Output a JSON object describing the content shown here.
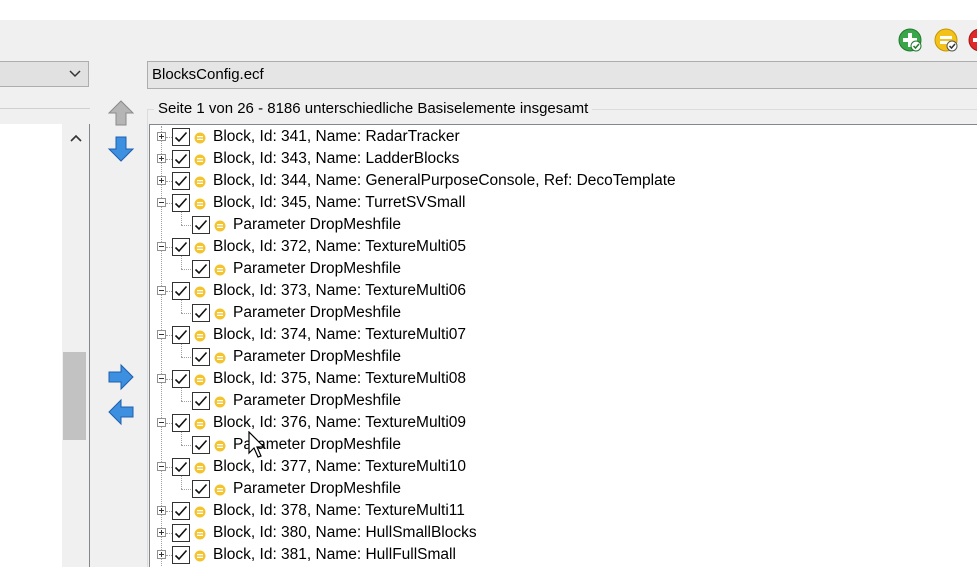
{
  "file_combo": {
    "value": "BlocksConfig.ecf"
  },
  "group": {
    "title": "Seite 1 von 26 - 8186 unterschiedliche Basiselemente insgesamt"
  },
  "toolbar": {
    "icons": [
      "add-icon",
      "edit-icon",
      "close-icon"
    ]
  },
  "colors": {
    "check_dot": "#f4c430",
    "arrow_blue": "#2f7fd6",
    "arrow_gray": "#9a9a9a"
  },
  "tree": {
    "rows": [
      {
        "level": 0,
        "expanded": false,
        "label": "Block, Id: 341, Name: RadarTracker"
      },
      {
        "level": 0,
        "expanded": false,
        "label": "Block, Id: 343, Name: LadderBlocks"
      },
      {
        "level": 0,
        "expanded": false,
        "label": "Block, Id: 344, Name: GeneralPurposeConsole, Ref: DecoTemplate"
      },
      {
        "level": 0,
        "expanded": true,
        "label": "Block, Id: 345, Name: TurretSVSmall"
      },
      {
        "level": 1,
        "label": "Parameter DropMeshfile"
      },
      {
        "level": 0,
        "expanded": true,
        "label": "Block, Id: 372, Name: TextureMulti05"
      },
      {
        "level": 1,
        "label": "Parameter DropMeshfile"
      },
      {
        "level": 0,
        "expanded": true,
        "label": "Block, Id: 373, Name: TextureMulti06"
      },
      {
        "level": 1,
        "label": "Parameter DropMeshfile"
      },
      {
        "level": 0,
        "expanded": true,
        "label": "Block, Id: 374, Name: TextureMulti07"
      },
      {
        "level": 1,
        "label": "Parameter DropMeshfile"
      },
      {
        "level": 0,
        "expanded": true,
        "label": "Block, Id: 375, Name: TextureMulti08"
      },
      {
        "level": 1,
        "label": "Parameter DropMeshfile"
      },
      {
        "level": 0,
        "expanded": true,
        "label": "Block, Id: 376, Name: TextureMulti09"
      },
      {
        "level": 1,
        "label": "Parameter DropMeshfile"
      },
      {
        "level": 0,
        "expanded": true,
        "label": "Block, Id: 377, Name: TextureMulti10"
      },
      {
        "level": 1,
        "label": "Parameter DropMeshfile"
      },
      {
        "level": 0,
        "expanded": false,
        "label": "Block, Id: 378, Name: TextureMulti11"
      },
      {
        "level": 0,
        "expanded": false,
        "label": "Block, Id: 380, Name: HullSmallBlocks"
      },
      {
        "level": 0,
        "expanded": false,
        "label": "Block, Id: 381, Name: HullFullSmall"
      }
    ]
  }
}
